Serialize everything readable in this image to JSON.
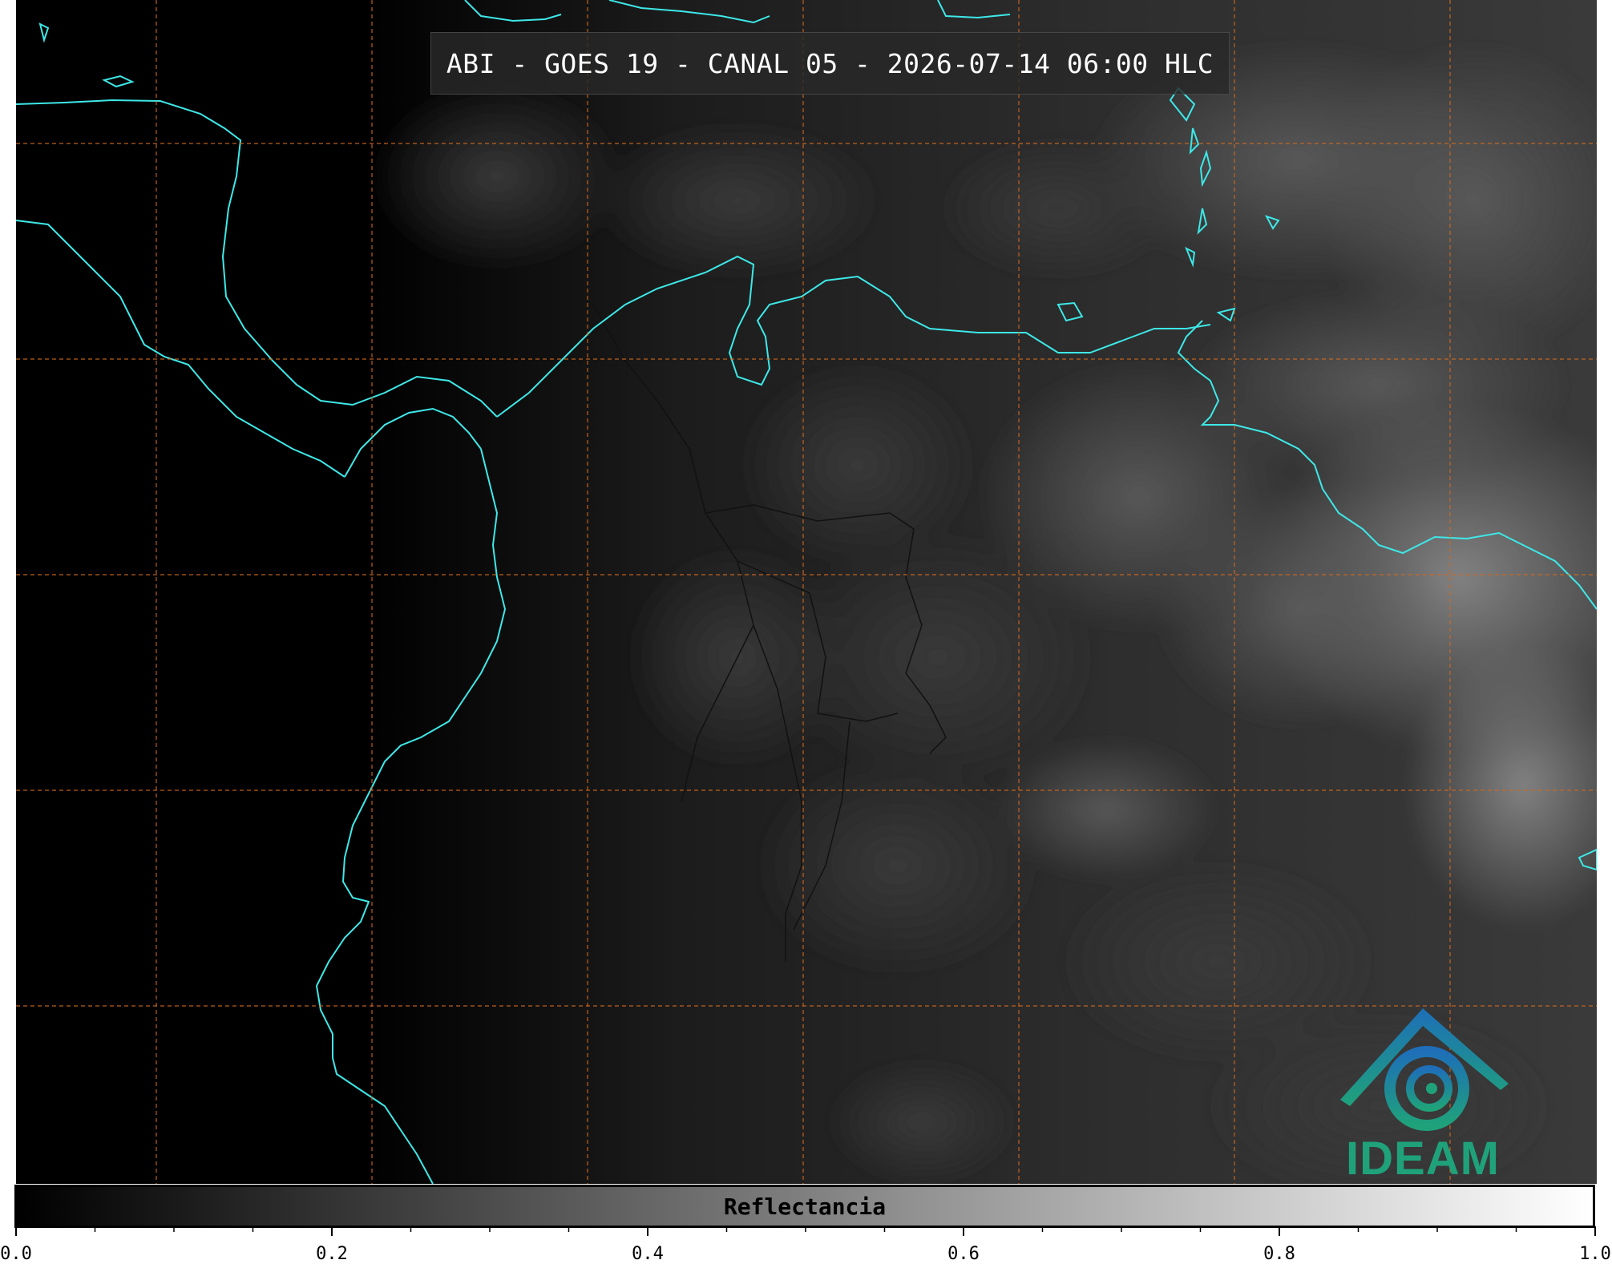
{
  "map": {
    "title": "ABI - GOES 19 - CANAL 05 - 2026-07-14 06:00 HLC",
    "coastline_color": "#3ee8e8",
    "gridline_color": "#d2691e",
    "border_color": "#111111"
  },
  "logo": {
    "text": "IDEAM",
    "colors": [
      "#1e6fb8",
      "#1fa27a"
    ]
  },
  "colorbar": {
    "label": "Reflectancia",
    "range": [
      0.0,
      1.0
    ],
    "colors": [
      "#000000",
      "#ffffff"
    ],
    "major_ticks": [
      "0.0",
      "0.2",
      "0.4",
      "0.6",
      "0.8",
      "1.0"
    ],
    "major_values": [
      0.0,
      0.2,
      0.4,
      0.6,
      0.8,
      1.0
    ],
    "minor_values": [
      0.05,
      0.1,
      0.15,
      0.25,
      0.3,
      0.35,
      0.45,
      0.5,
      0.55,
      0.65,
      0.7,
      0.75,
      0.85,
      0.9,
      0.95
    ]
  }
}
